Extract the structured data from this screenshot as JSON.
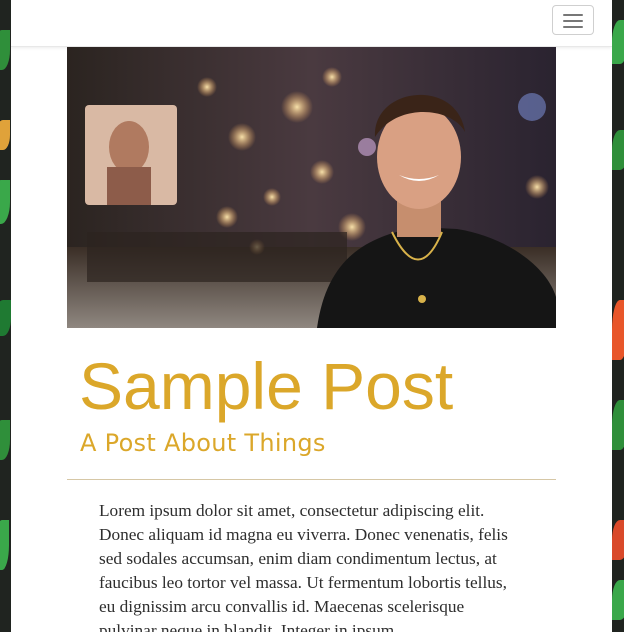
{
  "navbar": {
    "toggle_icon": "hamburger-menu-icon"
  },
  "hero": {
    "image_description": "hero-photo-icon"
  },
  "post": {
    "title": "Sample Post",
    "subtitle": "A Post About Things",
    "body": "Lorem ipsum dolor sit amet, consectetur adipiscing elit. Donec aliquam id magna eu viverra. Donec venenatis, felis sed sodales accumsan, enim diam condimentum lectus, at faucibus leo tortor vel massa. Ut fermentum lobortis tellus, eu dignissim arcu convallis id. Maecenas scelerisque pulvinar neque in blandit. Integer in ipsum"
  },
  "colors": {
    "accent": "#dba72a",
    "text": "#2e2e2e",
    "background_pattern": "#202420"
  }
}
